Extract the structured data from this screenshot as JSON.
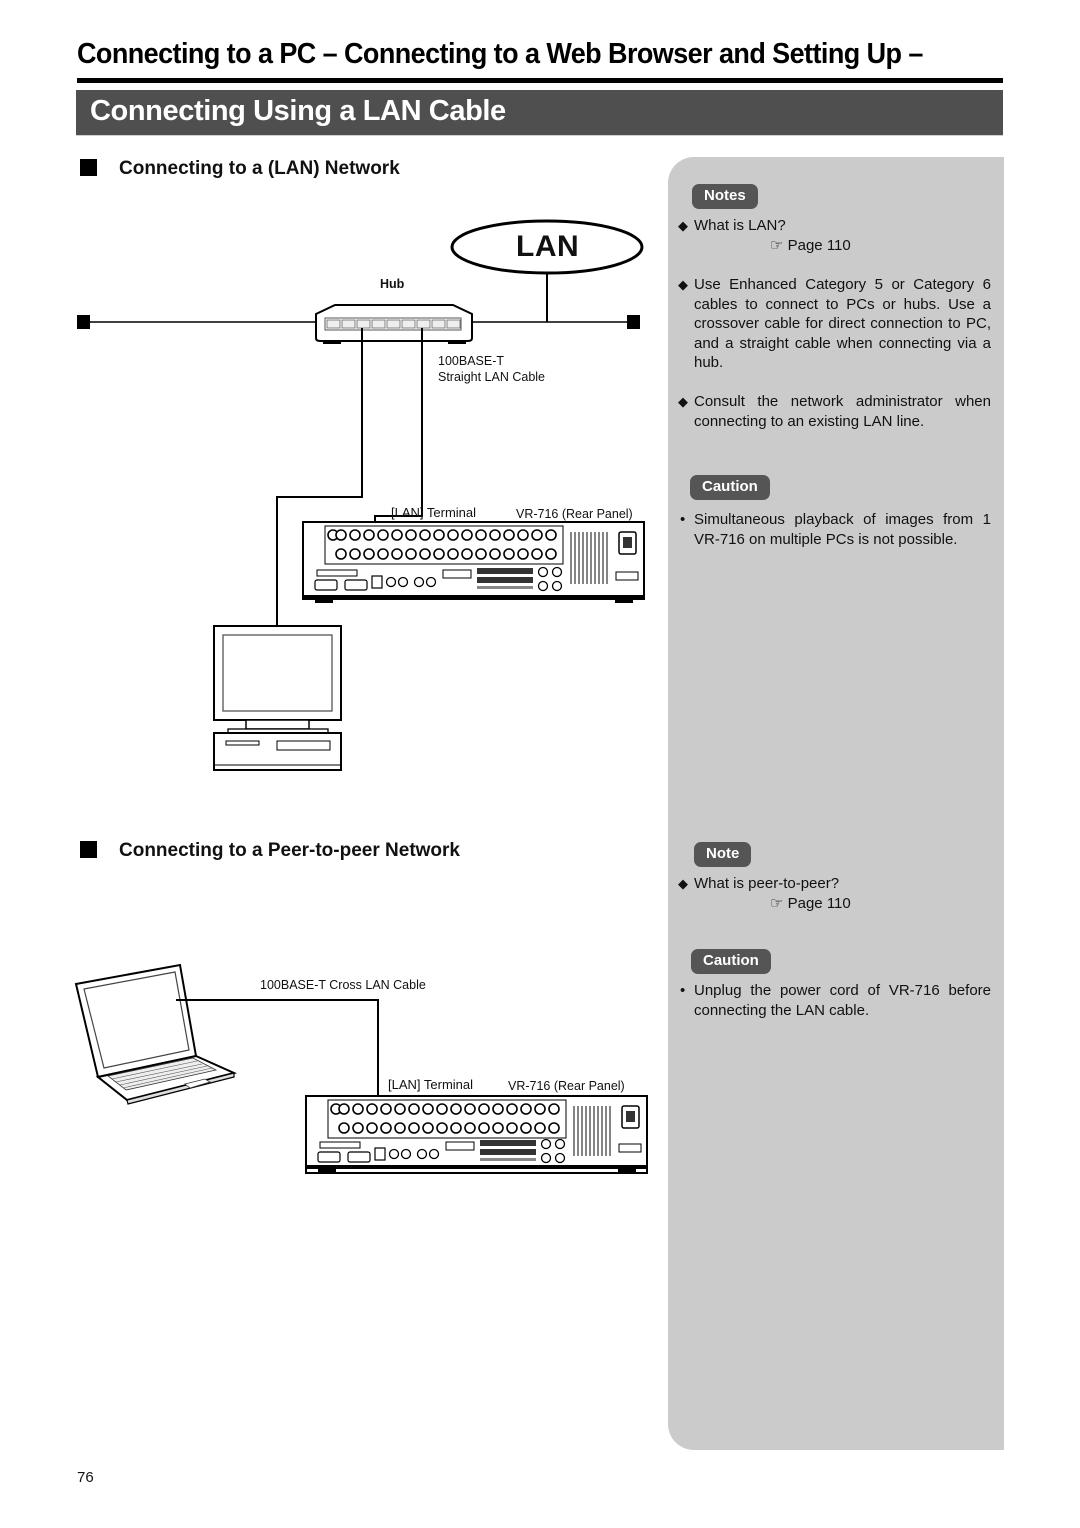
{
  "header": {
    "title": "Connecting to a PC – Connecting to a Web Browser and Setting Up –",
    "section": "Connecting Using a LAN Cable"
  },
  "lan_network": {
    "heading": "Connecting to a (LAN) Network",
    "diagram": {
      "cloud_label": "LAN",
      "hub_label": "Hub",
      "cable_label_line1": "100BASE-T",
      "cable_label_line2": "Straight LAN Cable",
      "terminal_label": "[LAN] Terminal",
      "device_label": "VR-716 (Rear Panel)"
    }
  },
  "peer_network": {
    "heading": "Connecting to a Peer-to-peer Network",
    "diagram": {
      "cable_label": "100BASE-T Cross LAN Cable",
      "terminal_label": "[LAN] Terminal",
      "device_label": "VR-716 (Rear Panel)"
    }
  },
  "sidebar": {
    "notes_badge": "Notes",
    "notes": [
      {
        "text": "What is LAN?",
        "ref": "☞ Page 110"
      },
      {
        "text": "Use Enhanced Category 5 or Category 6 cables to connect to PCs or hubs. Use a crossover cable for direct connection to PC, and a straight cable when connecting via a hub."
      },
      {
        "text": "Consult the network administrator when connecting to an existing LAN line."
      }
    ],
    "caution1_badge": "Caution",
    "caution1": [
      "Simultaneous playback of images from 1 VR-716 on multiple PCs is not possible."
    ],
    "note_badge": "Note",
    "note2": [
      {
        "text": "What is peer-to-peer?",
        "ref": "☞ Page 110"
      }
    ],
    "caution2_badge": "Caution",
    "caution2": [
      "Unplug the power cord of VR-716 before connecting the LAN cable."
    ]
  },
  "footer": {
    "page_number": "76"
  },
  "icons": {
    "note_marker": "diamond",
    "caution_marker": "bullet",
    "reference": "pointing-hand"
  },
  "colors": {
    "banner": "#4f4f4f",
    "sidebar": "#cbcbcb",
    "badge": "#555555"
  }
}
